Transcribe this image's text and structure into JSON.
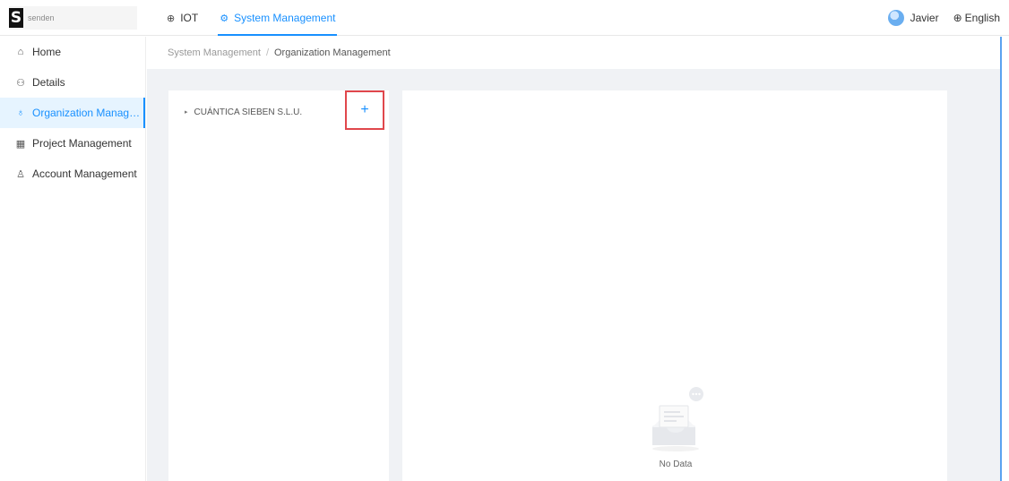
{
  "brand": {
    "mark": "S",
    "name": "senden"
  },
  "topnav": [
    {
      "label": "IOT",
      "icon": "globe-icon",
      "glyph": "⊕",
      "active": false
    },
    {
      "label": "System Management",
      "icon": "gear-icon",
      "glyph": "⚙",
      "active": true
    }
  ],
  "user": {
    "name": "Javier",
    "language": "English",
    "language_icon": "⊕"
  },
  "sidebar": {
    "items": [
      {
        "label": "Home",
        "icon": "home-icon",
        "glyph": "⌂",
        "active": false
      },
      {
        "label": "Details",
        "icon": "details-icon",
        "glyph": "⚇",
        "active": false
      },
      {
        "label": "Organization Management",
        "icon": "org-chart-icon",
        "glyph": "♁",
        "active": true
      },
      {
        "label": "Project Management",
        "icon": "grid-icon",
        "glyph": "▦",
        "active": false
      },
      {
        "label": "Account Management",
        "icon": "user-icon",
        "glyph": "♙",
        "active": false
      }
    ]
  },
  "breadcrumb": {
    "parent": "System Management",
    "separator": "/",
    "current": "Organization Management"
  },
  "tree": {
    "node_label": "CUÁNTICA SIEBEN S.L.U.",
    "caret": "▸",
    "add_label": "+"
  },
  "detail": {
    "empty_text": "No Data"
  },
  "colors": {
    "accent": "#1890ff",
    "highlight_box": "#e0474c",
    "content_bg": "#f0f2f5"
  }
}
